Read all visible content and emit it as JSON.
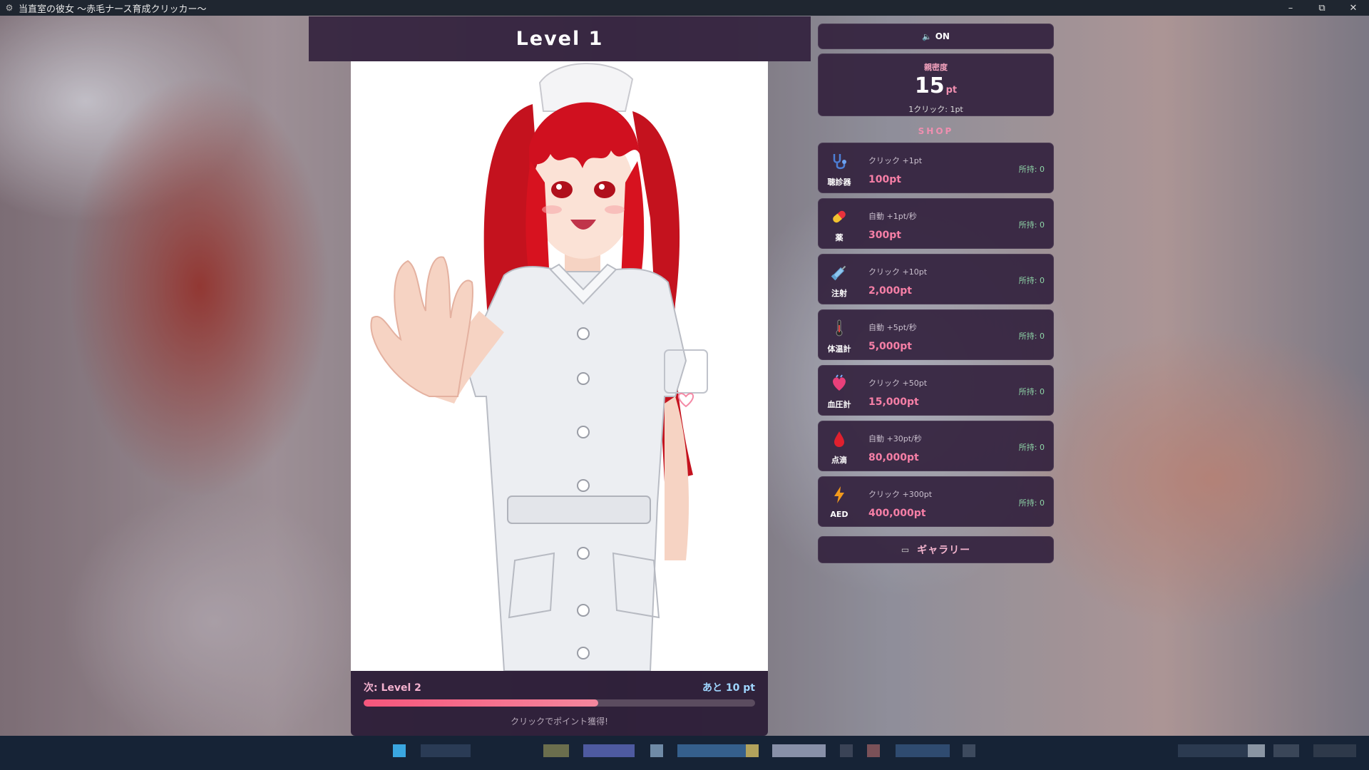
{
  "window": {
    "title": "当直室の彼女 〜赤毛ナース育成クリッカー〜",
    "minimize": "–",
    "restore": "⧉",
    "close": "✕"
  },
  "level": {
    "title": "Level 1"
  },
  "progress": {
    "next": "次: Level 2",
    "remaining": "あと 10 pt",
    "fraction": 0.6,
    "hint": "クリックでポイント獲得!"
  },
  "sound": {
    "label": "ON"
  },
  "affection": {
    "label": "親密度",
    "value": "15",
    "unit": "pt",
    "per_click": "1クリック: 1pt"
  },
  "shop": {
    "label": "SHOP",
    "items": [
      {
        "name": "聴診器",
        "effect": "クリック +1pt",
        "price": "100pt",
        "owned": "所持: 0",
        "icon": "stethoscope-icon"
      },
      {
        "name": "薬",
        "effect": "自動 +1pt/秒",
        "price": "300pt",
        "owned": "所持: 0",
        "icon": "pill-icon"
      },
      {
        "name": "注射",
        "effect": "クリック +10pt",
        "price": "2,000pt",
        "owned": "所持: 0",
        "icon": "syringe-icon"
      },
      {
        "name": "体温計",
        "effect": "自動 +5pt/秒",
        "price": "5,000pt",
        "owned": "所持: 0",
        "icon": "thermometer-icon"
      },
      {
        "name": "血圧計",
        "effect": "クリック +50pt",
        "price": "15,000pt",
        "owned": "所持: 0",
        "icon": "heart-icon"
      },
      {
        "name": "点滴",
        "effect": "自動 +30pt/秒",
        "price": "80,000pt",
        "owned": "所持: 0",
        "icon": "blood-drop-icon"
      },
      {
        "name": "AED",
        "effect": "クリック +300pt",
        "price": "400,000pt",
        "owned": "所持: 0",
        "icon": "lightning-icon"
      }
    ]
  },
  "gallery": {
    "label": "ギャラリー"
  },
  "colors": {
    "panel": "#34223e",
    "accent_pink": "#f67fa6",
    "progress_fill": "#f6567c",
    "owned_green": "#8fd6a8"
  }
}
